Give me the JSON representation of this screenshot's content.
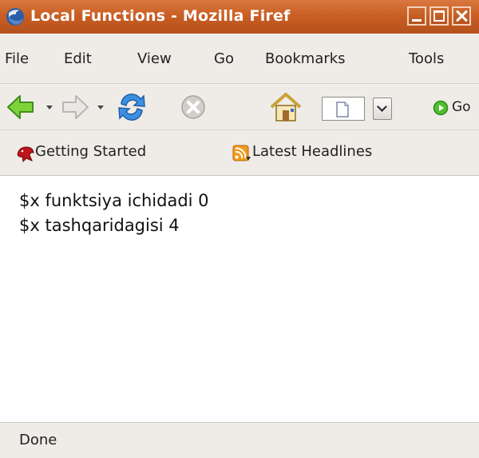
{
  "window": {
    "title": "Local Functions - Mozilla Firef"
  },
  "menu": [
    {
      "label": "File"
    },
    {
      "label": "Edit"
    },
    {
      "label": "View"
    },
    {
      "label": "Go"
    },
    {
      "label": "Bookmarks"
    },
    {
      "label": "Tools"
    }
  ],
  "toolbar": {
    "icons": [
      "back-arrow-icon",
      "forward-arrow-icon",
      "reload-icon",
      "stop-icon",
      "home-icon",
      "page-icon",
      "go-icon"
    ],
    "go_label": "Go"
  },
  "bookmarks": [
    {
      "label": "Getting Started"
    },
    {
      "label": "Latest Headlines"
    }
  ],
  "content": {
    "lines": [
      "$x funktsiya ichidadi 0",
      "$x tashqaridagisi 4"
    ]
  },
  "status": {
    "text": "Done"
  },
  "colors": {
    "titlebar": "#c95f24",
    "chrome": "#efebe7",
    "back_arrow": "#6ec12b",
    "reload": "#2f7fd3"
  }
}
